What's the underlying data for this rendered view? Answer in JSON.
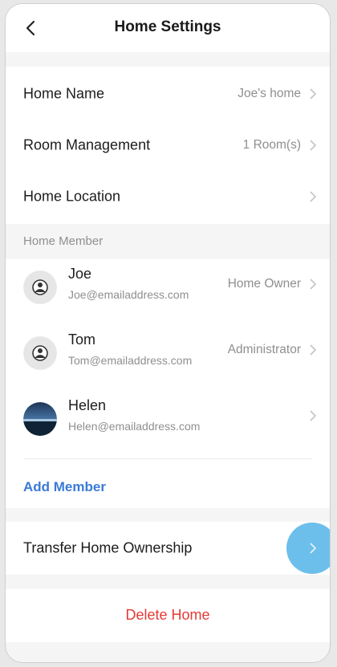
{
  "header": {
    "title": "Home Settings",
    "back_icon": "chevron-left-icon"
  },
  "settings": [
    {
      "label": "Home Name",
      "value": "Joe's home"
    },
    {
      "label": "Room Management",
      "value": "1 Room(s)"
    },
    {
      "label": "Home Location",
      "value": ""
    }
  ],
  "members_section": {
    "label": "Home Member",
    "members": [
      {
        "name": "Joe",
        "email": "Joe@emailaddress.com",
        "role": "Home Owner",
        "avatar": "default-user-avatar"
      },
      {
        "name": "Tom",
        "email": "Tom@emailaddress.com",
        "role": "Administrator",
        "avatar": "default-user-avatar"
      },
      {
        "name": "Helen",
        "email": "Helen@emailaddress.com",
        "role": "",
        "avatar": "landscape-photo-avatar"
      }
    ],
    "add_member_label": "Add Member"
  },
  "transfer": {
    "label": "Transfer Home Ownership"
  },
  "delete": {
    "label": "Delete Home"
  },
  "colors": {
    "accent_blue": "#3a7bd5",
    "danger_red": "#e53935",
    "touch_indicator": "#54b4e8",
    "background": "#f5f5f5"
  }
}
